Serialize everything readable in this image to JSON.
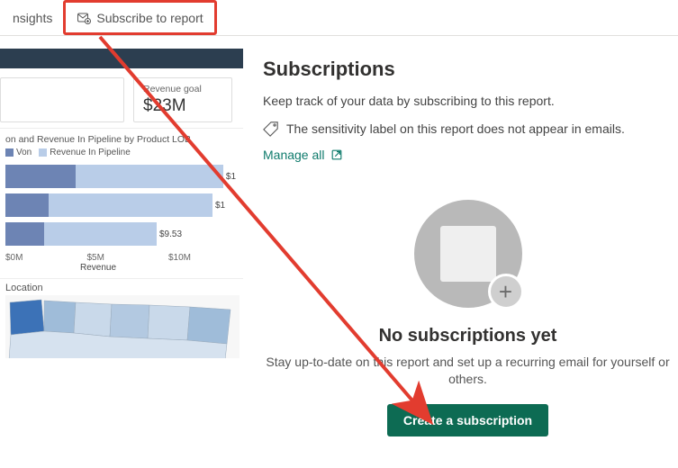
{
  "toolbar": {
    "insights_label": "nsights",
    "subscribe_label": "Subscribe to report"
  },
  "report": {
    "revenue_card": {
      "label": "Revenue goal",
      "value": "$23M"
    },
    "bar_chart_title": "on and Revenue In Pipeline by Product LOB",
    "legend": {
      "won": "Von",
      "pipeline": "Revenue In Pipeline"
    },
    "chart_data": {
      "type": "bar",
      "orientation": "horizontal",
      "xlabel": "Revenue",
      "ticks": [
        "$0M",
        "$5M",
        "$10M"
      ],
      "series": [
        {
          "name": "Won",
          "color": "#6d84b4"
        },
        {
          "name": "Revenue In Pipeline",
          "color": "#b9cde8"
        }
      ],
      "rows": [
        {
          "won": 78,
          "pipeline": 164,
          "label": "$1"
        },
        {
          "won": 48,
          "pipeline": 182,
          "label": "$1"
        },
        {
          "won": 43,
          "pipeline": 125,
          "label": "$9.53"
        }
      ]
    },
    "map_title": "Location"
  },
  "panel": {
    "title": "Subscriptions",
    "desc": "Keep track of your data by subscribing to this report.",
    "sensitivity": "The sensitivity label on this report does not appear in emails.",
    "manage_label": "Manage all",
    "empty_title": "No subscriptions yet",
    "empty_desc": "Stay up-to-date on this report and set up a recurring email for yourself or others.",
    "create_label": "Create a subscription"
  }
}
